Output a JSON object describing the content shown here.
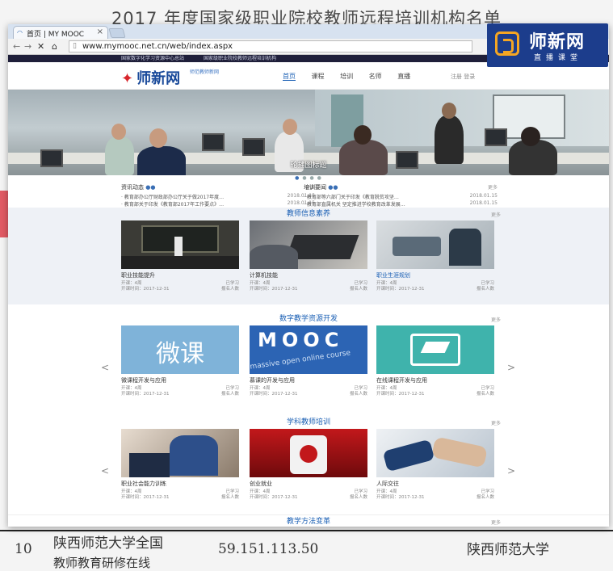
{
  "doc": {
    "title": "2017 年度国家级职业院校教师远程培训机构名单",
    "row_num": "10",
    "row_name": "陕西师范大学全国",
    "row_name2": "教师教育研修在线",
    "row_ip": "59.151.113.50",
    "row_org": "陕西师范大学"
  },
  "browser": {
    "tab_title": "首页 | MY MOOC",
    "url": "www.mymooc.net.cn/web/index.aspx"
  },
  "site": {
    "top_links": [
      "国家数字化学习资源中心总站",
      "国家级职业院校教师远程培训机构"
    ],
    "logo": "师新网",
    "logo_sub": "师范教师新网",
    "nav": [
      "首页",
      "课程",
      "培训",
      "名师",
      "直播"
    ],
    "nav_right": "注册 登录",
    "banner_caption": "轮播图标题",
    "news_left": {
      "header": "资讯动态",
      "more": "更多",
      "items": [
        {
          "text": "教育部办公厅财政部办公厅关于做2017年度…",
          "date": "2018.01.15"
        },
        {
          "text": "教育部关于印发《教育部2017年工作要点》…",
          "date": "2018.01.15"
        }
      ]
    },
    "news_right": {
      "header": "培训要闻",
      "more": "更多",
      "items": [
        {
          "text": "教育部等六部门关于印发《教育脱贫攻坚…",
          "date": "2018.01.15"
        },
        {
          "text": "教育部直属机关 坚定推进学校教育改革发展…",
          "date": "2018.01.15"
        }
      ]
    },
    "sections": [
      {
        "title": "教师信息素养",
        "more": "更多",
        "cards": [
          {
            "title": "职业技能提升",
            "m1": "开课：4周",
            "m1r": "已学习",
            "m2": "开课时间：2017-12-31",
            "m2r": "报名人数"
          },
          {
            "title": "计算机技能",
            "m1": "开课：4周",
            "m1r": "已学习",
            "m2": "开课时间：2017-12-31",
            "m2r": "报名人数"
          },
          {
            "title": "职业生涯规划",
            "m1": "开课：4周",
            "m1r": "已学习",
            "m2": "开课时间：2017-12-31",
            "m2r": "报名人数"
          }
        ]
      },
      {
        "title": "数字教学资源开发",
        "more": "更多",
        "cards": [
          {
            "title": "微课程开发与应用",
            "m1": "开课：4周",
            "m1r": "已学习",
            "m2": "开课时间：2017-12-31",
            "m2r": "报名人数",
            "thumb_text": "微课"
          },
          {
            "title": "慕课的开发与应用",
            "m1": "开课：4周",
            "m1r": "已学习",
            "m2": "开课时间：2017-12-31",
            "m2r": "报名人数",
            "thumb_text": "MOOC",
            "thumb_sub": "massive open online course"
          },
          {
            "title": "在线课程开发与应用",
            "m1": "开课：4周",
            "m1r": "已学习",
            "m2": "开课时间：2017-12-31",
            "m2r": "报名人数"
          }
        ]
      },
      {
        "title": "学科教师培训",
        "more": "更多",
        "cards": [
          {
            "title": "职业社会能力训练",
            "m1": "开课：4周",
            "m1r": "已学习",
            "m2": "开课时间：2017-12-31",
            "m2r": "报名人数"
          },
          {
            "title": "创业就业",
            "m1": "开课：4周",
            "m1r": "已学习",
            "m2": "开课时间：2017-12-31",
            "m2r": "报名人数"
          },
          {
            "title": "人际交往",
            "m1": "开课：4周",
            "m1r": "已学习",
            "m2": "开课时间：2017-12-31",
            "m2r": "报名人数"
          }
        ]
      },
      {
        "title": "教学方法变革",
        "more": "更多"
      }
    ]
  },
  "watermark": {
    "name": "师新网",
    "sub": "直播课堂"
  }
}
